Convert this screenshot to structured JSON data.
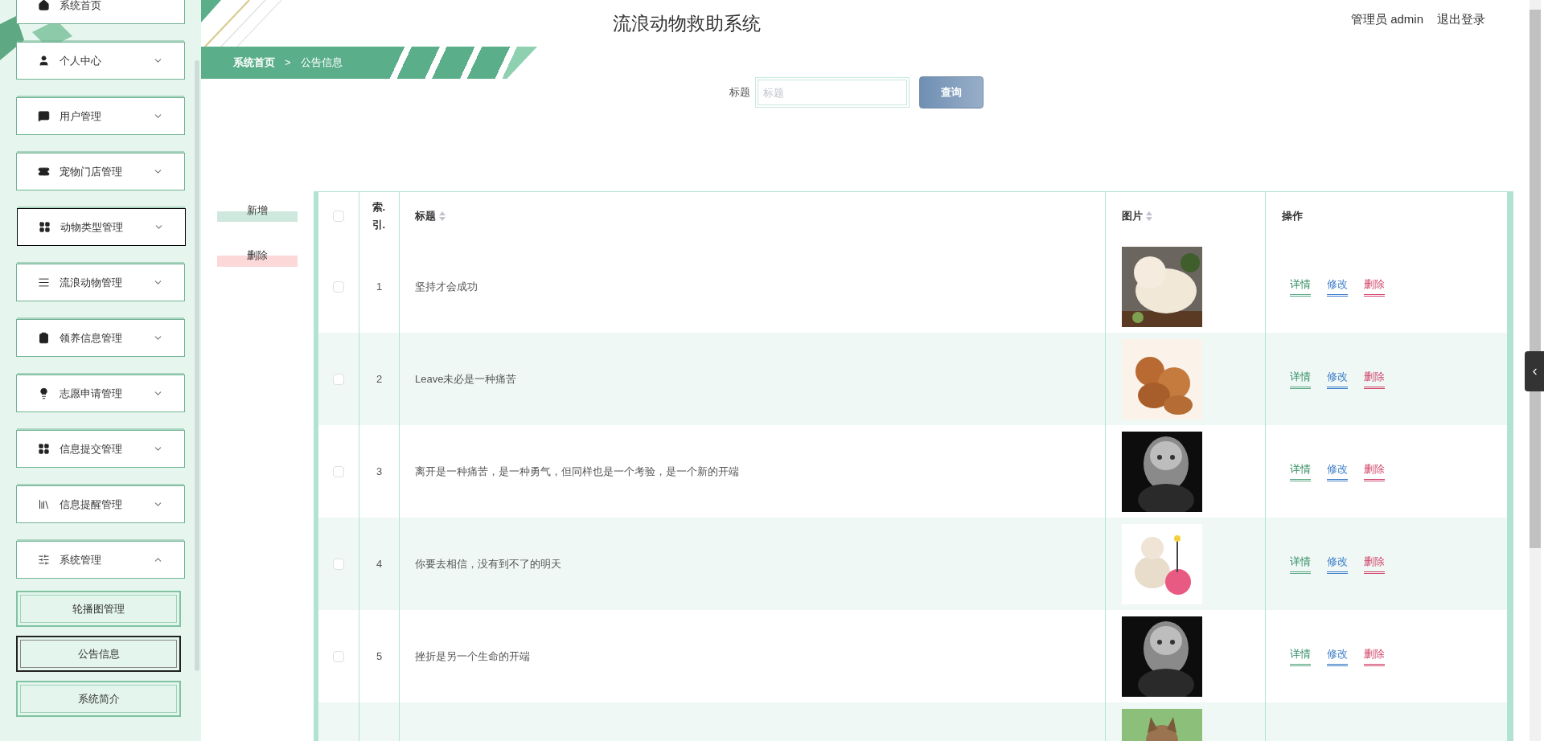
{
  "sidebar": {
    "items": [
      {
        "label": "系统首页",
        "hovered": false,
        "has_caret": false
      },
      {
        "label": "个人中心",
        "expanded": false,
        "hovered": false,
        "has_caret": true
      },
      {
        "label": "用户管理",
        "expanded": false,
        "hovered": false,
        "has_caret": true
      },
      {
        "label": "宠物门店管理",
        "expanded": false,
        "hovered": false,
        "has_caret": true
      },
      {
        "label": "动物类型管理",
        "expanded": false,
        "hovered": true,
        "has_caret": true
      },
      {
        "label": "流浪动物管理",
        "expanded": false,
        "hovered": false,
        "has_caret": true
      },
      {
        "label": "领养信息管理",
        "expanded": false,
        "hovered": false,
        "has_caret": true
      },
      {
        "label": "志愿申请管理",
        "expanded": false,
        "hovered": false,
        "has_caret": true
      },
      {
        "label": "信息提交管理",
        "expanded": false,
        "hovered": false,
        "has_caret": true
      },
      {
        "label": "信息提醒管理",
        "expanded": false,
        "hovered": false,
        "has_caret": true
      },
      {
        "label": "系统管理",
        "expanded": true,
        "hovered": false,
        "has_caret": true,
        "children": [
          {
            "label": "轮播图管理",
            "selected": false
          },
          {
            "label": "公告信息",
            "selected": true
          },
          {
            "label": "系统简介",
            "selected": false
          }
        ]
      }
    ]
  },
  "header": {
    "title": "流浪动物救助系统",
    "user": "管理员 admin",
    "logout": "退出登录"
  },
  "breadcrumb": [
    "系统首页",
    ">",
    "公告信息"
  ],
  "search": {
    "label": "标题",
    "placeholder": "标题",
    "button": "查询"
  },
  "actions": {
    "add": "新增",
    "delete": "删除"
  },
  "table": {
    "select_all": {
      "checked": false
    },
    "columns": [
      "索.引.",
      "标题",
      "图片",
      "操作"
    ],
    "sortable": [
      false,
      true,
      true,
      false
    ],
    "rows": [
      {
        "checked": false,
        "index": "1",
        "title": "坚持才会成功",
        "actions": [
          "详情",
          "修改",
          "删除"
        ]
      },
      {
        "checked": false,
        "index": "2",
        "title": "Leave未必是一种痛苦",
        "actions": [
          "详情",
          "修改",
          "删除"
        ]
      },
      {
        "checked": false,
        "index": "3",
        "title": "离开是一种痛苦，是一种勇气，但同样也是一个考验，是一个新的开端",
        "actions": [
          "详情",
          "修改",
          "删除"
        ]
      },
      {
        "checked": false,
        "index": "4",
        "title": "你要去相信，没有到不了的明天",
        "actions": [
          "详情",
          "修改",
          "删除"
        ]
      },
      {
        "checked": false,
        "index": "5",
        "title": "挫折是另一个生命的开端",
        "actions": [
          "详情",
          "修改",
          "删除"
        ]
      },
      {}
    ]
  }
}
